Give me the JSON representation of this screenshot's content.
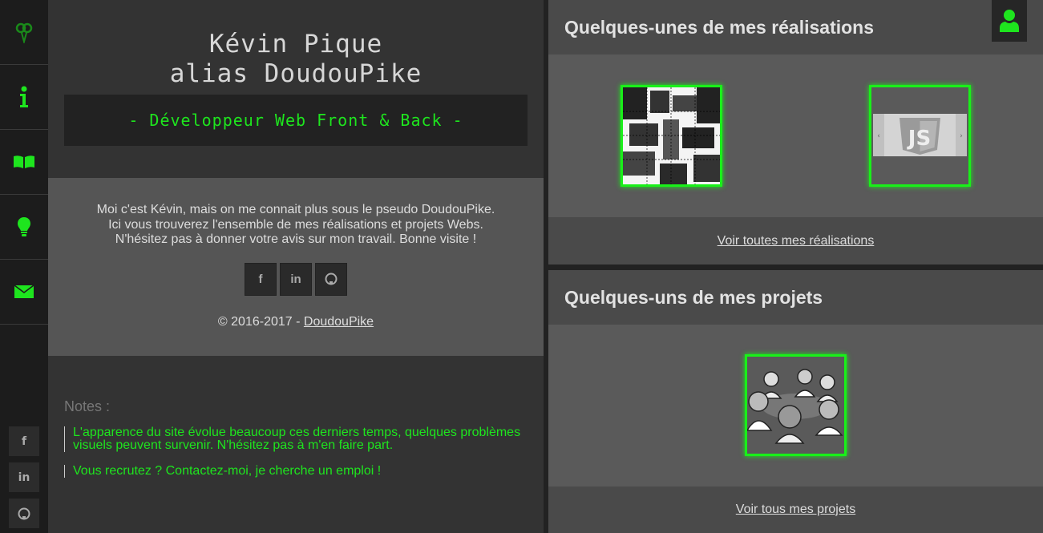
{
  "profile": {
    "name_line1": "Kévin Pique",
    "name_line2": "alias DoudouPike",
    "tagline": "- Développeur Web Front & Back -"
  },
  "about": {
    "line1": "Moi c'est Kévin, mais on me connait plus sous le pseudo DoudouPike.",
    "line2": "Ici vous trouverez l'ensemble de mes réalisations et projets Webs.",
    "line3": "N'hésitez pas à donner votre avis sur mon travail. Bonne visite !",
    "social": [
      {
        "icon": "facebook-icon",
        "glyph": "f"
      },
      {
        "icon": "linkedin-icon",
        "glyph": "in"
      },
      {
        "icon": "github-icon",
        "glyph": "gh"
      }
    ],
    "copyright_prefix": "© 2016-2017 - ",
    "copyright_link": "DoudouPike"
  },
  "notes": {
    "title": "Notes :",
    "items": [
      "L'apparence du site évolue beaucoup ces derniers temps, quelques problèmes visuels peuvent survenir. N'hésitez pas à m'en faire part.",
      "Vous recrutez ? Contactez-moi, je cherche un emploi !"
    ]
  },
  "sidebar": {
    "items": [
      {
        "icon": "logo-icon"
      },
      {
        "icon": "info-icon"
      },
      {
        "icon": "book-icon"
      },
      {
        "icon": "lightbulb-icon"
      },
      {
        "icon": "envelope-icon"
      }
    ],
    "social": [
      {
        "icon": "facebook-icon",
        "glyph": "f"
      },
      {
        "icon": "linkedin-icon",
        "glyph": "in"
      },
      {
        "icon": "github-icon",
        "glyph": "gh"
      }
    ]
  },
  "realisations": {
    "title": "Quelques-unes de mes réalisations",
    "link": "Voir toutes mes réalisations"
  },
  "projets": {
    "title": "Quelques-uns de mes projets",
    "link": "Voir tous mes projets"
  },
  "colors": {
    "accent": "#1ee51e",
    "background": "#1c1c1c",
    "panel": "#5a5a5a"
  }
}
